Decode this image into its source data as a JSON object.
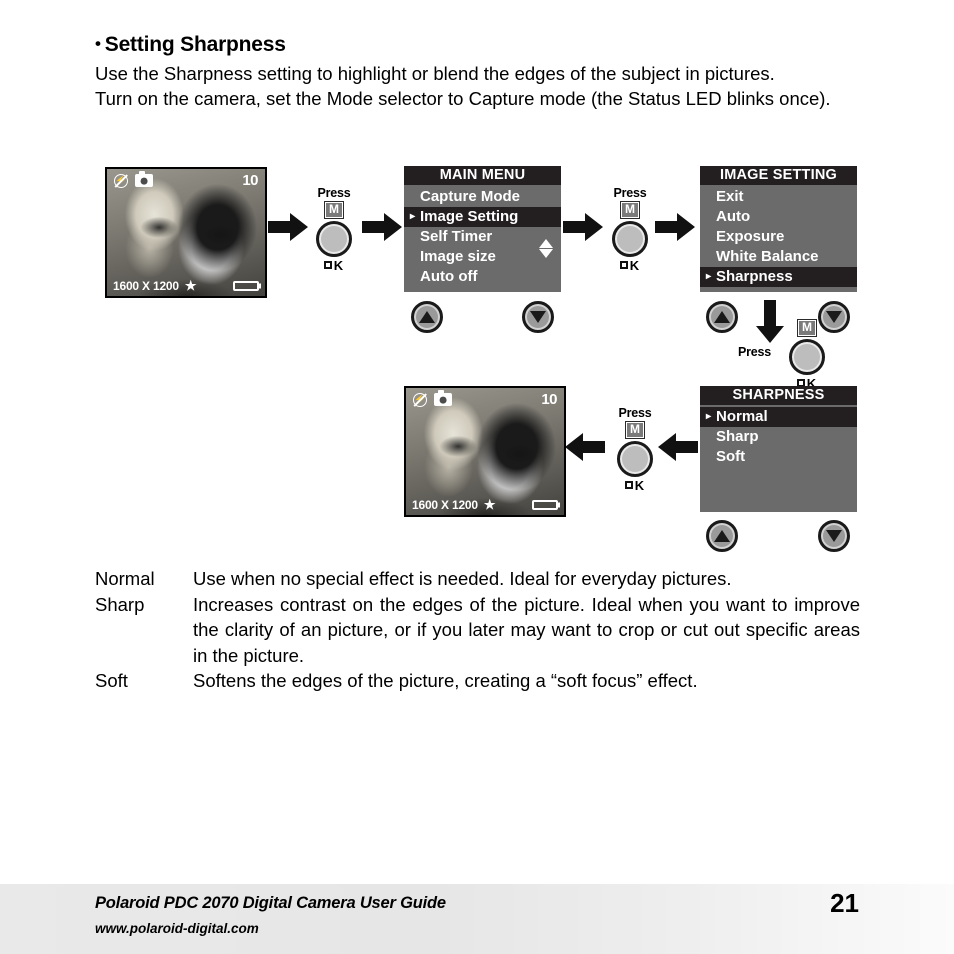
{
  "heading": {
    "bullet": "•",
    "text": "Setting Sharpness"
  },
  "intro": {
    "p1": "Use the Sharpness setting to highlight or blend the edges of the subject in pictures.",
    "p2": "Turn on the camera, set the Mode selector to Capture mode (the Status LED blinks once)."
  },
  "lcd": {
    "top_icons": [
      "no-flash-icon",
      "camera-icon"
    ],
    "shots_remaining": "10",
    "resolution": "1600 X 1200",
    "quality_star": "★",
    "battery": "battery-full-icon"
  },
  "controls": {
    "press_label": "Press",
    "mode_badge": "M",
    "ok_label": "K",
    "ok_square": "□"
  },
  "menus": {
    "main": {
      "title": "MAIN MENU",
      "items": [
        {
          "label": "Capture Mode",
          "selected": false
        },
        {
          "label": "Image Setting",
          "selected": true
        },
        {
          "label": "Self Timer",
          "selected": false
        },
        {
          "label": "Image size",
          "selected": false
        },
        {
          "label": "Auto off",
          "selected": false
        }
      ],
      "scroll_up": "▲",
      "scroll_down": "▼"
    },
    "image_setting": {
      "title": "IMAGE SETTING",
      "items": [
        {
          "label": "Exit",
          "selected": false
        },
        {
          "label": "Auto",
          "selected": false
        },
        {
          "label": "Exposure",
          "selected": false
        },
        {
          "label": "White Balance",
          "selected": false
        },
        {
          "label": "Sharpness",
          "selected": true
        }
      ]
    },
    "sharpness": {
      "title": "SHARPNESS",
      "items": [
        {
          "label": "Normal",
          "selected": true
        },
        {
          "label": "Sharp",
          "selected": false
        },
        {
          "label": "Soft",
          "selected": false
        }
      ]
    }
  },
  "nav_buttons": {
    "up": "up-arrow-button",
    "down": "down-arrow-button"
  },
  "flow_arrows": {
    "right": "arrow-right",
    "left": "arrow-left",
    "down": "arrow-down"
  },
  "definitions": [
    {
      "term": "Normal",
      "desc": "Use when no special effect is needed. Ideal for everyday pictures."
    },
    {
      "term": "Sharp",
      "desc": "Increases contrast on the edges of the picture. Ideal when you want to improve the clarity of an picture, or if you later may want to crop or cut out specific areas in the picture."
    },
    {
      "term": "Soft",
      "desc": "Softens the edges of the picture, creating a “soft focus” effect."
    }
  ],
  "footer": {
    "title": "Polaroid PDC 2070 Digital Camera User Guide",
    "url": "www.polaroid-digital.com",
    "page": "21"
  }
}
